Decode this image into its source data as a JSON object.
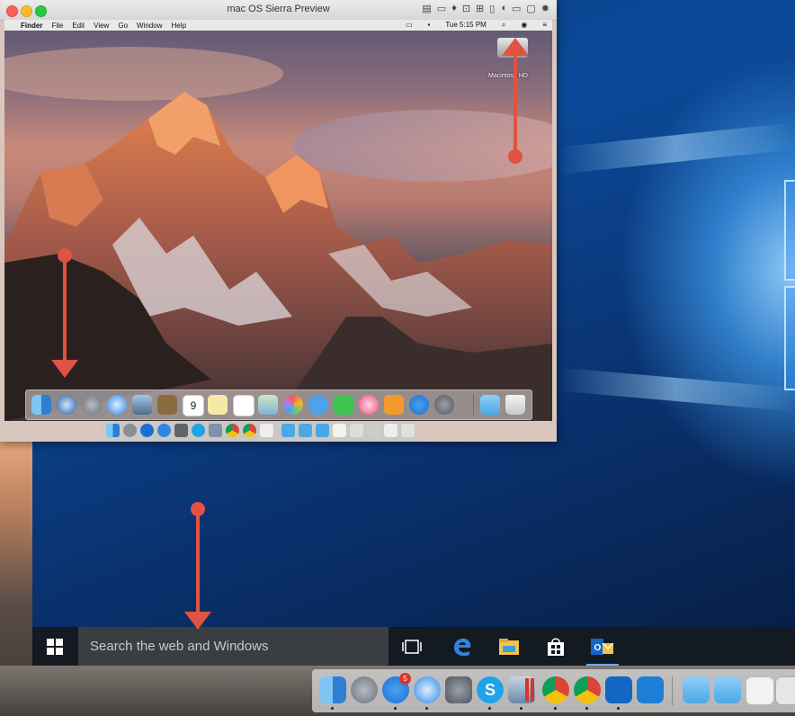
{
  "vm_window": {
    "title": "mac OS Sierra Preview"
  },
  "guest_menubar": {
    "apple_icon": "apple-icon",
    "items": [
      "Finder",
      "File",
      "Edit",
      "View",
      "Go",
      "Window",
      "Help"
    ],
    "clock": "Tue 5:15 PM"
  },
  "desktop_items": {
    "drive_label": "Macintosh HD"
  },
  "windows_taskbar": {
    "search_placeholder": "Search the web and Windows"
  },
  "host_dock": {
    "badges": {
      "app_store": "5",
      "calendar": "9"
    }
  },
  "colors": {
    "arrow": "#e05241",
    "taskbar": "#141a22",
    "search_box": "#3a3d42",
    "windows_blue": "#0b4a9a"
  },
  "icons": [
    "windows-start-icon",
    "task-view-icon",
    "edge-icon",
    "file-explorer-icon",
    "store-icon",
    "outlook-icon",
    "finder-icon",
    "launchpad-icon",
    "app-store-icon",
    "safari-icon",
    "system-preferences-icon",
    "skype-icon",
    "chrome-icon",
    "trash-icon",
    "macintosh-hd-icon"
  ]
}
